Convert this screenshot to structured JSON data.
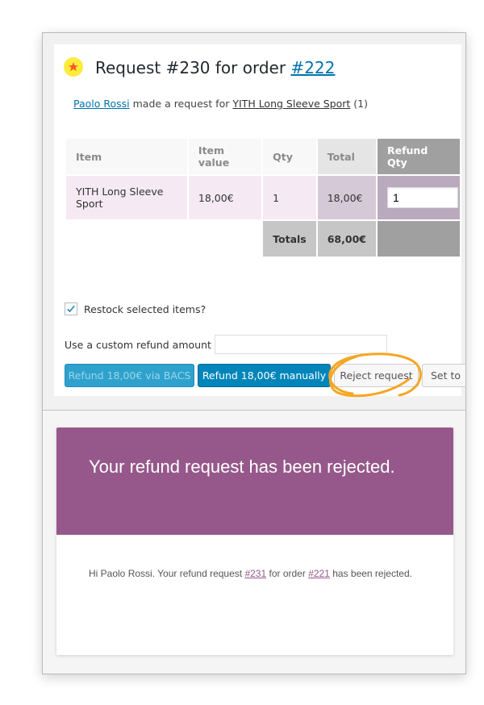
{
  "request": {
    "title_prefix": "Request #230 for order ",
    "order_link": "#222",
    "customer_link": "Paolo Rossi",
    "made_request_text": " made a request for ",
    "product_link": "YITH Long Sleeve Sport",
    "quantity_suffix": " (1)",
    "icon": "star-icon"
  },
  "table": {
    "headers": [
      "Item",
      "Item value",
      "Qty",
      "Total",
      "Refund Qty"
    ],
    "rows": [
      {
        "item": "YITH Long Sleeve Sport",
        "item_value": "18,00€",
        "qty": "1",
        "total": "18,00€",
        "refund_qty": "1"
      }
    ],
    "totals_label": "Totals",
    "totals_value": "68,00€"
  },
  "options": {
    "restock_label": "Restock selected items?",
    "restock_checked": true,
    "custom_amount_label": "Use a custom refund amount",
    "custom_amount_value": ""
  },
  "buttons": {
    "refund_bacs": "Refund 18,00€ via BACS",
    "refund_manual": "Refund 18,00€ manually",
    "reject": "Reject request",
    "set_to": "Set to"
  },
  "email": {
    "heading": "Your refund request has been rejected.",
    "greeting": "Hi Paolo Rossi. Your refund request ",
    "request_link": "#231",
    "for_order_text": " for order ",
    "order_link": "#221",
    "closing_text": " has been rejected."
  },
  "colors": {
    "wp_blue": "#0073aa",
    "email_purple": "#96588a",
    "highlight_orange": "#f5a623",
    "icon_yellow": "#ffeb3b",
    "icon_star": "#ff5722"
  }
}
